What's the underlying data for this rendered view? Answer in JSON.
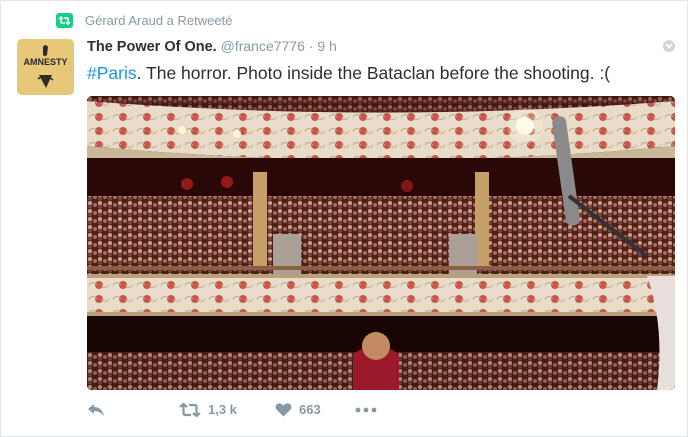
{
  "context": {
    "retweet_text": "Gérard Araud a Retweeté"
  },
  "author": {
    "name": "The Power Of One.",
    "handle": "@france7776",
    "separator": "·",
    "time": "9 h",
    "avatar_text": "AMNESTY"
  },
  "tweet": {
    "hashtag": "#Paris",
    "text": ". The horror. Photo inside the Bataclan before the shooting. :("
  },
  "actions": {
    "retweet_count": "1,3 k",
    "like_count": "663",
    "icons": [
      "reply-icon",
      "retweet-icon",
      "heart-icon",
      "more-icon"
    ]
  },
  "colors": {
    "accent": "#1b95e0",
    "retweet_green": "#19cf86",
    "muted": "#8899a6",
    "text": "#292f33"
  }
}
